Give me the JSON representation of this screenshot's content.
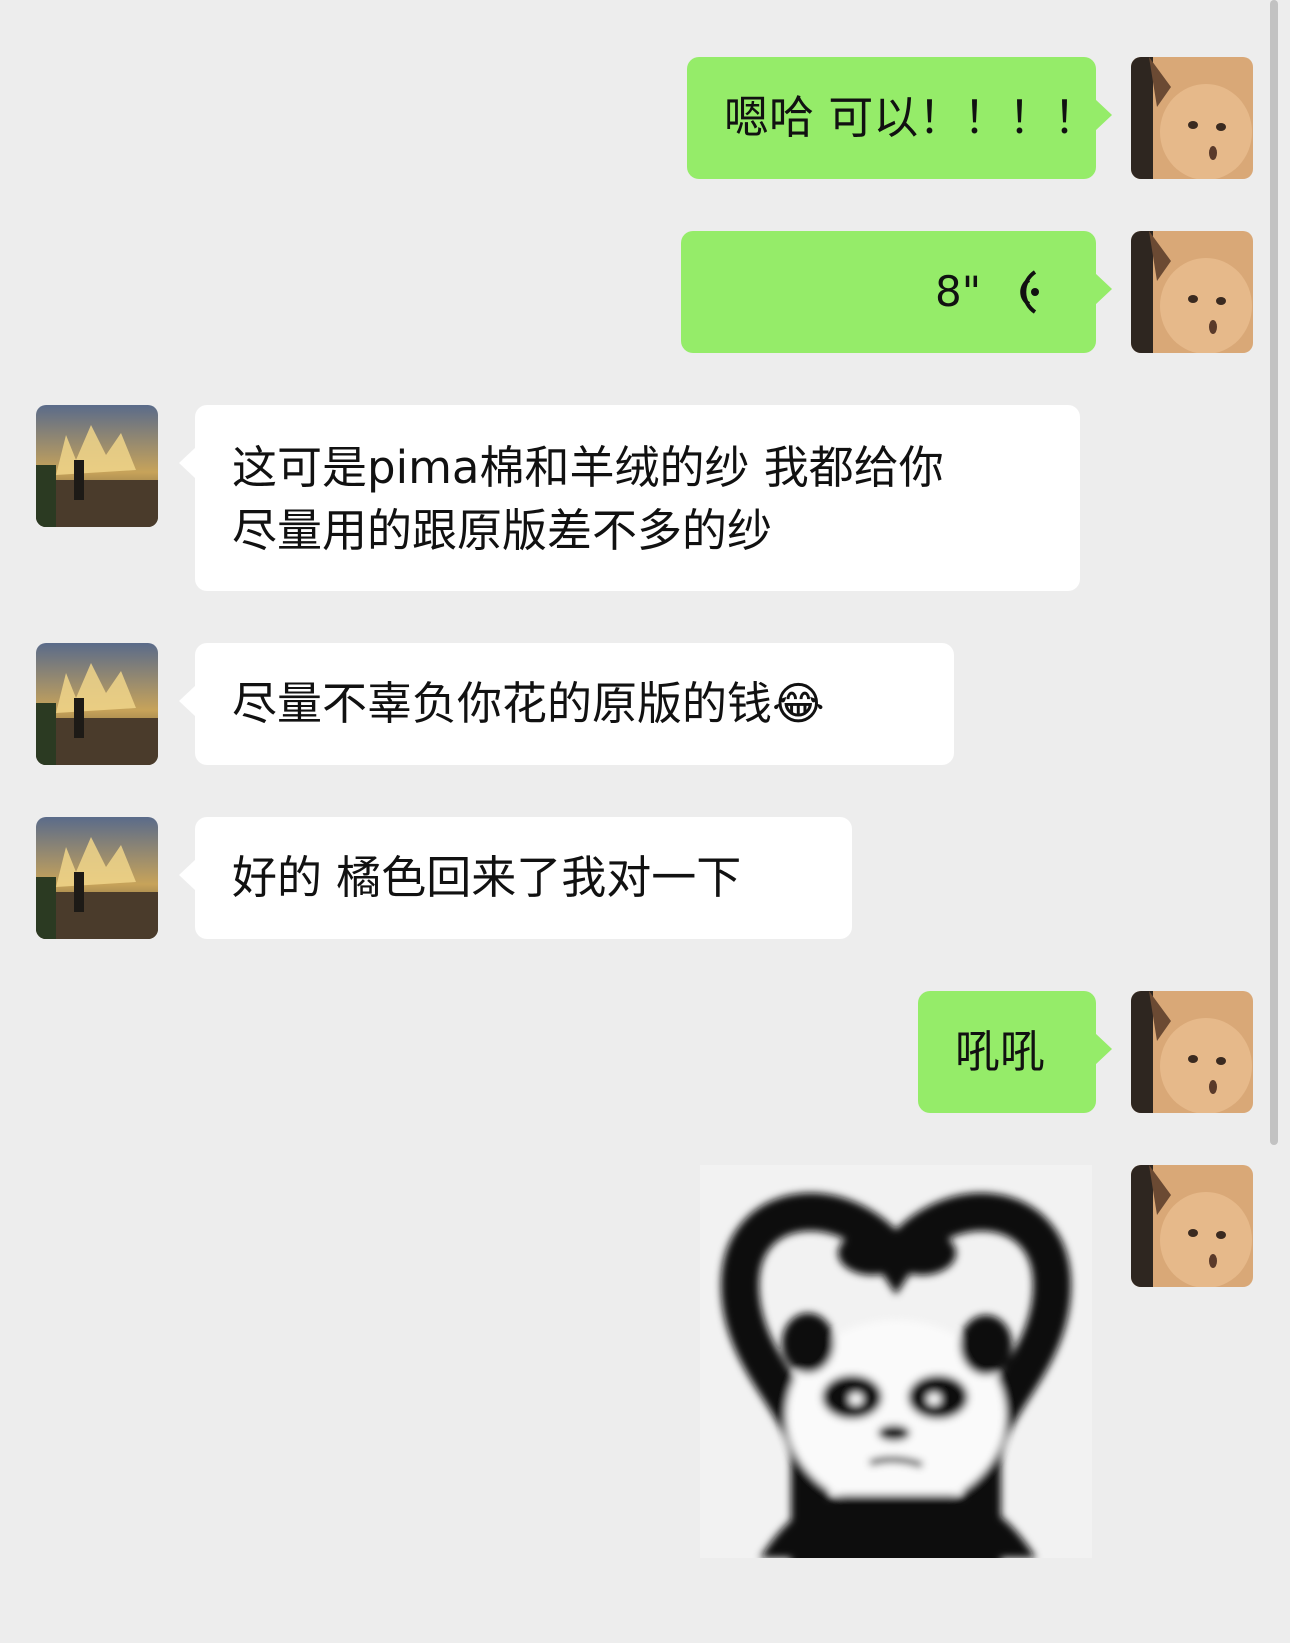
{
  "chat": {
    "messages": [
      {
        "sender": "self",
        "type": "text",
        "text": "嗯哈 可以！！！！"
      },
      {
        "sender": "self",
        "type": "voice",
        "duration": "8\""
      },
      {
        "sender": "other",
        "type": "text",
        "line1": "这可是pima棉和羊绒的纱 我都给你",
        "line2": "尽量用的跟原版差不多的纱"
      },
      {
        "sender": "other",
        "type": "text",
        "text": "尽量不辜负你花的原版的钱😂"
      },
      {
        "sender": "other",
        "type": "text",
        "text": "好的 橘色回来了我对一下"
      },
      {
        "sender": "self",
        "type": "text",
        "text": "吼吼"
      },
      {
        "sender": "self",
        "type": "sticker",
        "icon": "panda-heart-sticker"
      }
    ]
  },
  "colors": {
    "background": "#ededed",
    "self_bubble": "#95ec69",
    "other_bubble": "#ffffff"
  }
}
